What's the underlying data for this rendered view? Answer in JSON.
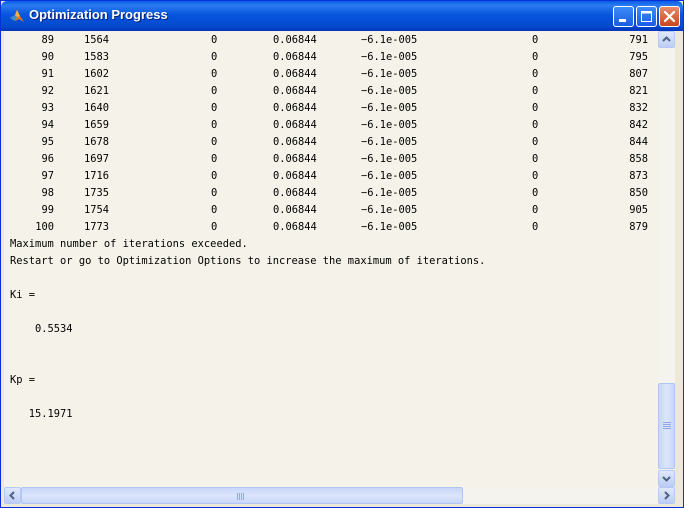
{
  "window": {
    "title": "Optimization Progress",
    "title_bar_color": "#0a5de6"
  },
  "console": {
    "table_rows": [
      [
        "89",
        "1564",
        "0",
        "0.06844",
        "−6.1e-005",
        "0",
        "791"
      ],
      [
        "90",
        "1583",
        "0",
        "0.06844",
        "−6.1e-005",
        "0",
        "795"
      ],
      [
        "91",
        "1602",
        "0",
        "0.06844",
        "−6.1e-005",
        "0",
        "807"
      ],
      [
        "92",
        "1621",
        "0",
        "0.06844",
        "−6.1e-005",
        "0",
        "821"
      ],
      [
        "93",
        "1640",
        "0",
        "0.06844",
        "−6.1e-005",
        "0",
        "832"
      ],
      [
        "94",
        "1659",
        "0",
        "0.06844",
        "−6.1e-005",
        "0",
        "842"
      ],
      [
        "95",
        "1678",
        "0",
        "0.06844",
        "−6.1e-005",
        "0",
        "844"
      ],
      [
        "96",
        "1697",
        "0",
        "0.06844",
        "−6.1e-005",
        "0",
        "858"
      ],
      [
        "97",
        "1716",
        "0",
        "0.06844",
        "−6.1e-005",
        "0",
        "873"
      ],
      [
        "98",
        "1735",
        "0",
        "0.06844",
        "−6.1e-005",
        "0",
        "850"
      ],
      [
        "99",
        "1754",
        "0",
        "0.06844",
        "−6.1e-005",
        "0",
        "905"
      ],
      [
        "100",
        "1773",
        "0",
        "0.06844",
        "−6.1e-005",
        "0",
        "879"
      ]
    ],
    "message_line_1": "Maximum number of iterations exceeded.",
    "message_line_2": "Restart or go to Optimization Options to increase the maximum of iterations.",
    "ki_label": "Ki =",
    "ki_value": "    0.5534",
    "kp_label": "Kp =",
    "kp_value": "   15.1971"
  },
  "icons": {
    "app": "matlab-icon",
    "minimize": "minimize-icon",
    "maximize": "maximize-icon",
    "close": "close-icon"
  }
}
